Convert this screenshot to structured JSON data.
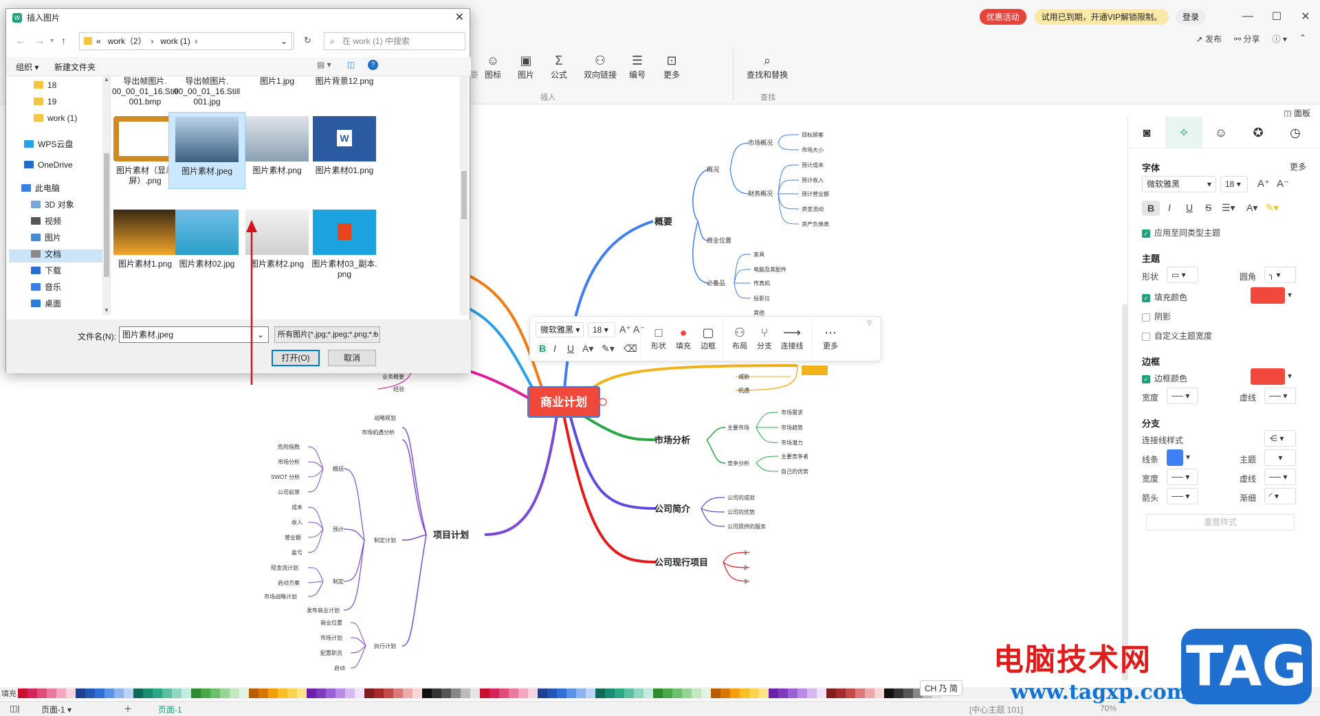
{
  "topbar": {
    "promo": "优惠活动",
    "vip_notice": "试用已到期，开通VIP解锁限制。",
    "login": "登录",
    "publish": "发布",
    "share": "分享",
    "help": "?"
  },
  "ribbon": {
    "items": [
      {
        "label": "注释",
        "icon": "annotation-icon"
      },
      {
        "label": "图标",
        "icon": "sticker-icon"
      },
      {
        "label": "图片",
        "icon": "image-icon"
      },
      {
        "label": "公式",
        "icon": "formula-icon"
      },
      {
        "label": "双向链接",
        "icon": "link-icon"
      },
      {
        "label": "编号",
        "icon": "numbering-icon"
      },
      {
        "label": "更多",
        "icon": "more-icon"
      },
      {
        "label": "查找和替换",
        "icon": "find-replace-icon"
      }
    ],
    "group_insert": "插入",
    "group_find": "查找",
    "partial_left": "要",
    "panel_toggle": "面板"
  },
  "dialog": {
    "title": "插入图片",
    "path": [
      "work（2）",
      "work (1)"
    ],
    "path_prefix": "«",
    "search_placeholder": "在 work (1) 中搜索",
    "organize": "组织 ▾",
    "new_folder": "新建文件夹",
    "nav": [
      {
        "label": "18",
        "type": "folder"
      },
      {
        "label": "19",
        "type": "folder"
      },
      {
        "label": "work (1)",
        "type": "folder"
      },
      {
        "label": "WPS云盘",
        "type": "cloud"
      },
      {
        "label": "OneDrive",
        "type": "onedrive"
      },
      {
        "label": "此电脑",
        "type": "pc"
      },
      {
        "label": "3D 对象",
        "type": "3d"
      },
      {
        "label": "视频",
        "type": "video"
      },
      {
        "label": "图片",
        "type": "pictures"
      },
      {
        "label": "文档",
        "type": "docs"
      },
      {
        "label": "下载",
        "type": "download"
      },
      {
        "label": "音乐",
        "type": "music"
      },
      {
        "label": "桌面",
        "type": "desktop"
      }
    ],
    "files_row0": [
      "导出帧图片.\n00_00_01_16.Still\n001.bmp",
      "导出帧图片.\n00_00_01_16.Still\n001.jpg",
      "图片1.jpg",
      "图片背景12.png"
    ],
    "files_row1": [
      "图片素材（显示\n屏）.png",
      "图片素材.jpeg",
      "图片素材.png",
      "图片素材01.png"
    ],
    "files_row2": [
      "图片素材1.png",
      "图片素材02.jpg",
      "图片素材2.png",
      "图片素材03_副本.\npng"
    ],
    "filename_label": "文件名(N):",
    "filename_value": "图片素材.jpeg",
    "filter_value": "所有图片(*.jpg;*.jpeg;*.png;*.b",
    "open_button": "打开(O)",
    "cancel_button": "取消"
  },
  "float_toolbar": {
    "font": "微软雅黑",
    "size": "18",
    "labels": [
      "形状",
      "填充",
      "边框",
      "布局",
      "分支",
      "连接线",
      "更多"
    ]
  },
  "mindmap": {
    "root": "商业计划",
    "branches": {
      "overview": "概要",
      "market": "市场分析",
      "company": "公司简介",
      "project": "公司现行项目",
      "plan": "项目计划"
    },
    "overview_sub": [
      "概况",
      "商业位置",
      "必备品"
    ],
    "overview_l3": [
      "市场概况",
      "财务概况"
    ],
    "overview_leaves": [
      "目标顾客",
      "市场大小",
      "预计成本",
      "预计收入",
      "预计营业额",
      "资金流动",
      "资产负债表"
    ],
    "necessities": [
      "家具",
      "电脑及其配件",
      "传真机",
      "投影仪",
      "其他"
    ],
    "hidden_swot": [
      "威胁",
      "机遇"
    ],
    "market_sub": [
      "主要市场",
      "竞争分析"
    ],
    "market_leaves": [
      "市场需求",
      "市场趋势",
      "市场潜力",
      "主要竞争者",
      "自己的优势"
    ],
    "company_leaves": [
      "公司的成就",
      "公司的优势",
      "公司提供的服务"
    ],
    "project_leaves": [
      "1",
      "2",
      "3"
    ],
    "plan_sub": [
      "战略规划",
      "市场机遇分析",
      "制定计划",
      "执行计划"
    ],
    "plan_groups": [
      "概括",
      "预计",
      "制定"
    ],
    "plan_leaves_a": [
      "危险指数",
      "市场分析",
      "SWOT 分析",
      "公司前景"
    ],
    "plan_leaves_b": [
      "成本",
      "收入",
      "营业额",
      "盈亏"
    ],
    "plan_leaves_c": [
      "现金流计划",
      "启动方案",
      "市场战略计划"
    ],
    "plan_extra": "发布商业计划",
    "exec_leaves": [
      "商业位置",
      "市场计划",
      "配置职员",
      "启动"
    ],
    "upper_left": [
      "业务概要",
      "经验"
    ]
  },
  "right_panel": {
    "font_section": "字体",
    "more": "更多",
    "font": "微软雅黑",
    "size": "18",
    "apply_same": "应用至同类型主题",
    "theme_section": "主题",
    "shape": "形状",
    "corner": "圆角",
    "fill_color": "填充颜色",
    "shadow": "阴影",
    "custom_width": "自定义主题宽度",
    "border_section": "边框",
    "border_color": "边框颜色",
    "width": "宽度",
    "dash": "虚线",
    "branch_section": "分支",
    "connector_style": "连接线样式",
    "line": "线条",
    "theme": "主题",
    "arrow": "箭头",
    "gradient": "渐细",
    "reset": "重置样式",
    "accent": "#f0493c",
    "line_color": "#3f7ef3"
  },
  "bottom": {
    "fill": "填充",
    "page_tab": "页面-1",
    "page_tab_active": "页面-1",
    "status": "[中心主题 101]",
    "zoom": "70%",
    "ime": "CH 乃 简"
  },
  "watermark": {
    "site_cn": "电脑技术网",
    "url": "www.tagxp.com",
    "tag": "TAG"
  }
}
